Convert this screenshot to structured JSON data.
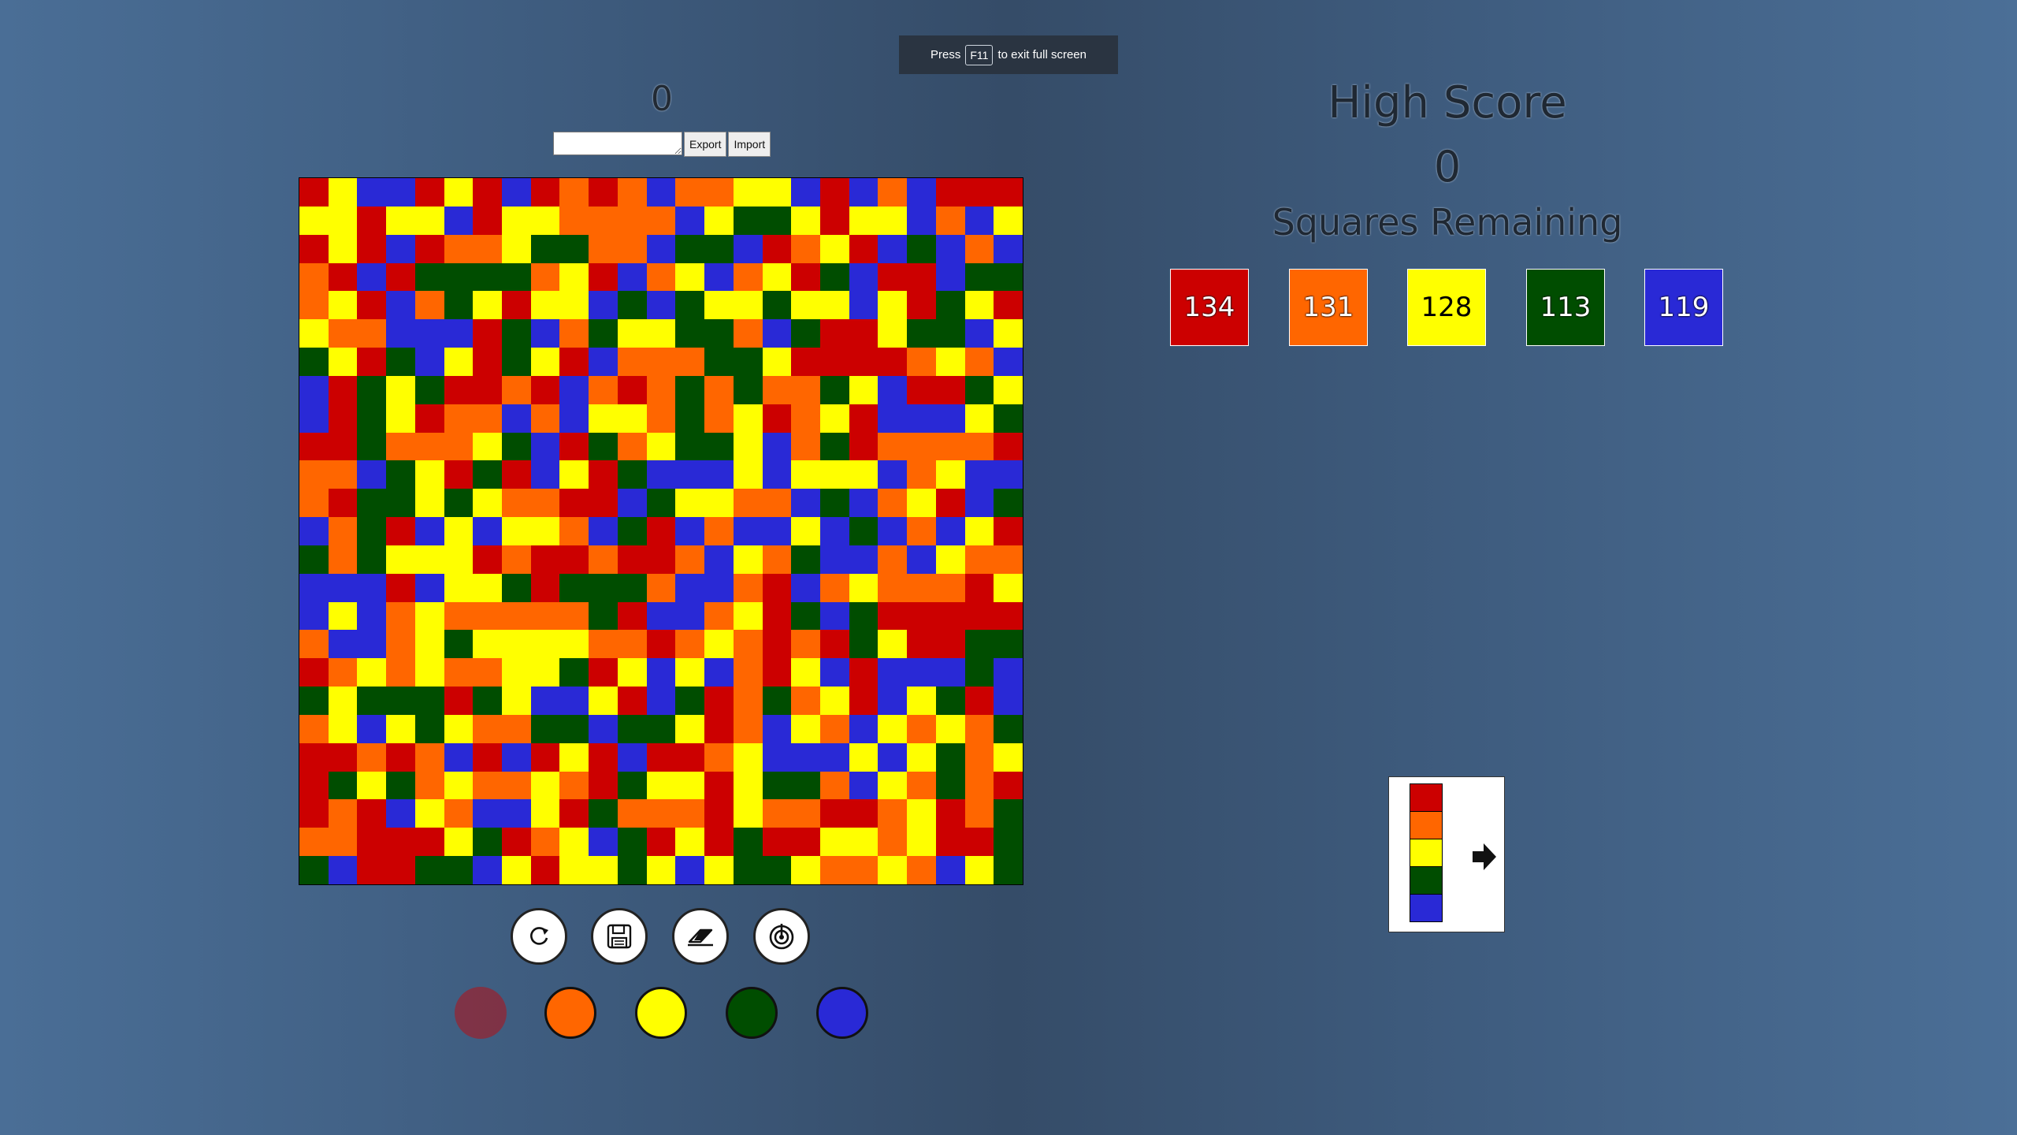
{
  "fullscreen_notice": {
    "prefix": "Press",
    "key": "F11",
    "suffix": "to exit full screen"
  },
  "score": "0",
  "io": {
    "export_label": "Export",
    "import_label": "Import",
    "field_value": ""
  },
  "high_score": {
    "title": "High Score",
    "value": "0"
  },
  "squares_remaining": {
    "title": "Squares Remaining",
    "counts": [
      {
        "color": "red",
        "value": "134"
      },
      {
        "color": "orange",
        "value": "131"
      },
      {
        "color": "yellow",
        "value": "128"
      },
      {
        "color": "green",
        "value": "113"
      },
      {
        "color": "blue",
        "value": "119"
      }
    ]
  },
  "palette": {
    "R": "#cc0000",
    "O": "#ff6600",
    "Y": "#ffff00",
    "G": "#004d00",
    "B": "#2929d6"
  },
  "board": {
    "size": 25,
    "rows": [
      "RYBBRYRBROROBOOYYBRBOBRRR",
      "YYRYYBRYYOOOOBYGGYRYYBOBY",
      "RYRBROOYGGOOBGGBROYRBGBOB",
      "ORBRGGGGOYRBOYBOYRGBRRBGG",
      "OYRBOGYRYYBGBGYYGYYBYRGYR",
      "YOOBBBRGBOGYYGGOBGRRYGGBY",
      "GYRGBYRGYRBOOOGGYRRRROYOB",
      "BRGYGRRORBOROGOGOOGYBRRGY",
      "BRGYROOBOBYYOGOYROYRBBBYG",
      "RRGOOOYGBRGOYGGYBOGROOOOR",
      "OOBGYRGRBYRGBBBYBYYYBOYBB",
      "ORGGYGYOORRBGYYOOBGBOYRBG",
      "BOGRBYBYYOBGRBOBBYBGBOBYR",
      "GOGYYYRORRORROBYOGBBOBYOO",
      "BBBRBYYGRGGGOBBORBOYOOORY",
      "BYBOYOOOOOGRBBOYRGBGRRRRR",
      "OBBOYGYYYYOOROYORORGYRRGG",
      "ROYOYOOYYGRYBYBORYBRBBBGB",
      "GYGGGRGYBBYRBGROGOYRBYGRB",
      "OYBYGYOOGGBGGYROBYOBYOYOG",
      "RROROBRBRYRBRROYBBBYBYGOY",
      "RGYGOYOOYORGYYRYGGOBYOGOR",
      "RORBYOBBYRGOOORYOORROYROG",
      "OORRRYGROYBGRYRGRRYYOYRRG",
      "GBRRGGBYRYYGYBYGGYOOYOBYG"
    ]
  },
  "tools": [
    {
      "name": "restart",
      "icon": "restart-icon"
    },
    {
      "name": "save",
      "icon": "save-icon"
    },
    {
      "name": "eraser",
      "icon": "eraser-icon"
    },
    {
      "name": "target",
      "icon": "target-icon"
    }
  ],
  "color_buttons": [
    {
      "color": "red",
      "hex": "#cc0000",
      "disabled": true
    },
    {
      "color": "orange",
      "hex": "#ff6600",
      "disabled": false
    },
    {
      "color": "yellow",
      "hex": "#ffff00",
      "disabled": false
    },
    {
      "color": "green",
      "hex": "#004d00",
      "disabled": false
    },
    {
      "color": "blue",
      "hex": "#2929d6",
      "disabled": false
    }
  ],
  "legend": {
    "colors": [
      "#cc0000",
      "#ff6600",
      "#ffff00",
      "#004d00",
      "#2929d6"
    ],
    "icon": "arrow-right-icon"
  }
}
